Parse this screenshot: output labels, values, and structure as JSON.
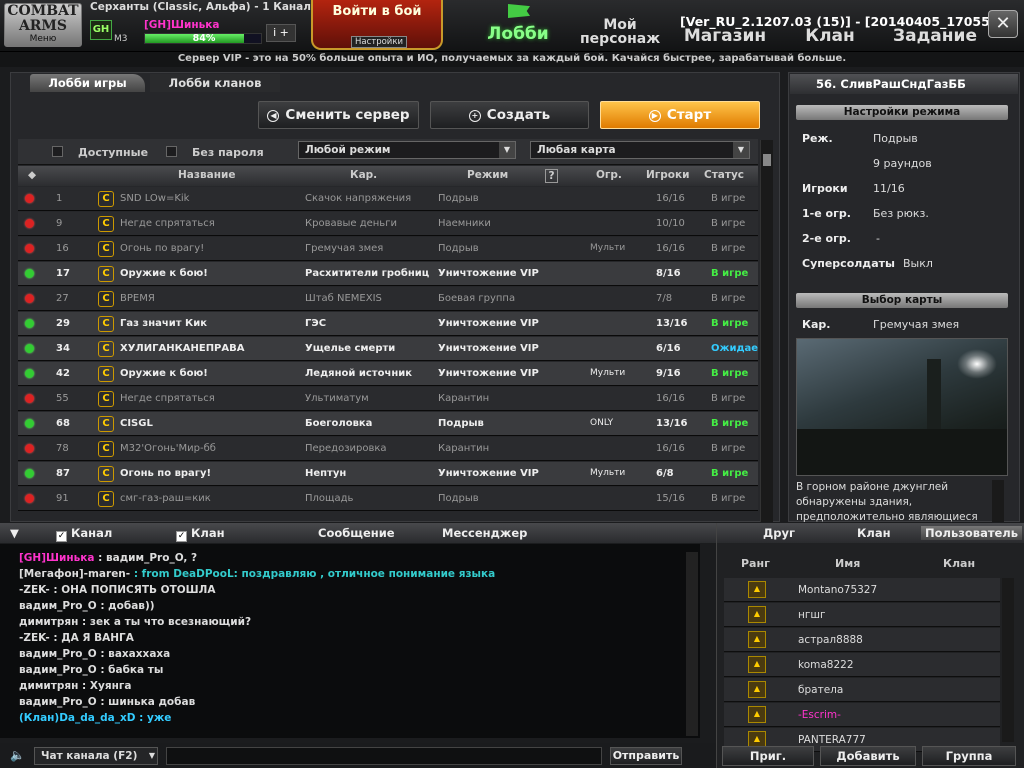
{
  "top": {
    "logo_line1": "COMBAT",
    "logo_line2": "ARMS",
    "logo_menu": "Меню",
    "server": "Серханты (Classic, Альфа) - 1 Канал",
    "rank_badge": "GH",
    "rank": "M3",
    "player": "[GH]Шинька",
    "xp_percent": "84%",
    "xp_fraction": 0.84,
    "user_icon": "i +",
    "battle_label": "Войти в бой",
    "settings_label": "Настройки",
    "nav_lobby": "Лобби",
    "nav_char": "Мой персонаж",
    "nav_shop": "Магазин",
    "nav_clan": "Клан",
    "nav_task": "Задание",
    "version": "[Ver_RU_2.1207.03 (15)] - [20140405_170551]",
    "close": "✕"
  },
  "vip_banner": "Сервер VIP - это на 50% больше опыта и ИО, получаемых за каждый бой. Качайся быстрее, зарабатывай больше.",
  "lobby": {
    "tab_game": "Лобби игры",
    "tab_clans": "Лобби кланов",
    "btn_server": "Сменить сервер",
    "btn_create": "Создать",
    "btn_start": "Старт",
    "filter_available": "Доступные",
    "filter_nopass": "Без пароля",
    "mode_select": "Любой режим",
    "map_select": "Любая карта",
    "col_name": "Название",
    "col_map": "Кар.",
    "col_mode": "Режим",
    "col_help": "?",
    "col_limit": "Огр.",
    "col_players": "Игроки",
    "col_status": "Статус",
    "rooms": [
      {
        "num": "1",
        "name": "SND LOw=Kik",
        "map": "Скачок напряжения",
        "mode": "Подрыв",
        "limit": "",
        "players": "16/16",
        "status": "В игре",
        "open": false
      },
      {
        "num": "9",
        "name": "Негде спрятаться",
        "map": "Кровавые деньги",
        "mode": "Наемники",
        "limit": "",
        "players": "10/10",
        "status": "В игре",
        "open": false
      },
      {
        "num": "16",
        "name": "Огонь по врагу!",
        "map": "Гремучая змея",
        "mode": "Подрыв",
        "limit": "Мульти",
        "players": "16/16",
        "status": "В игре",
        "open": false
      },
      {
        "num": "17",
        "name": "Оружие к бою!",
        "map": "Расхитители гробниц",
        "mode": "Уничтожение VIP",
        "limit": "",
        "players": "8/16",
        "status": "В игре",
        "open": true
      },
      {
        "num": "27",
        "name": "ВРЕМЯ",
        "map": "Штаб NEMEXIS",
        "mode": "Боевая группа",
        "limit": "",
        "players": "7/8",
        "status": "В игре",
        "open": false
      },
      {
        "num": "29",
        "name": "Газ значит Кик",
        "map": "ГЭС",
        "mode": "Уничтожение VIP",
        "limit": "",
        "players": "13/16",
        "status": "В игре",
        "open": true
      },
      {
        "num": "34",
        "name": "ХУЛИГАНКАНЕПРАВА",
        "map": "Ущелье смерти",
        "mode": "Уничтожение VIP",
        "limit": "",
        "players": "6/16",
        "status": "Ожидает",
        "open": true
      },
      {
        "num": "42",
        "name": "Оружие к бою!",
        "map": "Ледяной источник",
        "mode": "Уничтожение VIP",
        "limit": "Мульти",
        "players": "9/16",
        "status": "В игре",
        "open": true
      },
      {
        "num": "55",
        "name": "Негде спрятаться",
        "map": "Ультиматум",
        "mode": "Карантин",
        "limit": "",
        "players": "16/16",
        "status": "В игре",
        "open": false
      },
      {
        "num": "68",
        "name": "CISGL",
        "map": "Боеголовка",
        "mode": "Подрыв",
        "limit": "ONLY",
        "players": "13/16",
        "status": "В игре",
        "open": true
      },
      {
        "num": "78",
        "name": "M32'Огонь'Мир-бб",
        "map": "Передозировка",
        "mode": "Карантин",
        "limit": "",
        "players": "16/16",
        "status": "В игре",
        "open": false
      },
      {
        "num": "87",
        "name": "Огонь по врагу!",
        "map": "Нептун",
        "mode": "Уничтожение VIP",
        "limit": "Мульти",
        "players": "6/8",
        "status": "В игре",
        "open": true
      },
      {
        "num": "91",
        "name": "смг-газ-раш=кик",
        "map": "Площадь",
        "mode": "Подрыв",
        "limit": "",
        "players": "15/16",
        "status": "В игре",
        "open": false
      }
    ]
  },
  "room": {
    "title": "56. СливРашСндГазББ",
    "settings_title": "Настройки режима",
    "mode_k": "Реж.",
    "mode_v": "Подрыв",
    "rounds": "9 раундов",
    "players_k": "Игроки",
    "players_v": "11/16",
    "w1_k": "1-е огр.",
    "w1_v": "Без рюкз.",
    "w2_k": "2-е огр.",
    "w2_v": "-",
    "super_k": "Суперсолдаты",
    "super_v": "Выкл",
    "map_title": "Выбор карты",
    "map_k": "Кар.",
    "map_v": "Гремучая змея",
    "map_desc": "В горном районе джунглей обнаружены здания, предположительно являющиеся"
  },
  "chat": {
    "tab_channel": "Канал",
    "tab_clan": "Клан",
    "tab_msg": "Сообщение",
    "tab_messenger": "Мессенджер",
    "lines": [
      {
        "name": "[GH]Шинька",
        "text": ": вадим_Pro_O, ?",
        "ncolor": "#f3c",
        "tcolor": "#ddd"
      },
      {
        "name": "[Мегафон]-maren-",
        "text": ": from DeaDPooL: поздравляю , отличное понимание языка",
        "ncolor": "#ddd",
        "tcolor": "#3cc"
      },
      {
        "name": "-ZEK-",
        "text": ": ОНА ПОПИСЯТЬ ОТОШЛА",
        "ncolor": "#ddd",
        "tcolor": "#ddd"
      },
      {
        "name": "вадим_Pro_O",
        "text": ": добав))",
        "ncolor": "#ddd",
        "tcolor": "#ddd"
      },
      {
        "name": "димитрян",
        "text": ": зек а ты что всезнающий?",
        "ncolor": "#ddd",
        "tcolor": "#ddd"
      },
      {
        "name": "-ZEK-",
        "text": ": ДА Я ВАНГА",
        "ncolor": "#ddd",
        "tcolor": "#ddd"
      },
      {
        "name": "вадим_Pro_O",
        "text": ": вахаххаха",
        "ncolor": "#ddd",
        "tcolor": "#ddd"
      },
      {
        "name": "вадим_Pro_O",
        "text": ": бабка ты",
        "ncolor": "#ddd",
        "tcolor": "#ddd"
      },
      {
        "name": "димитрян",
        "text": ": Хуянга",
        "ncolor": "#ddd",
        "tcolor": "#ddd"
      },
      {
        "name": "вадим_Pro_O",
        "text": ": шинька добав",
        "ncolor": "#ddd",
        "tcolor": "#ddd"
      },
      {
        "name": "(Клан)Da_da_da_xD",
        "text": ": уже",
        "ncolor": "#3cf",
        "tcolor": "#3cf"
      }
    ],
    "channel_select": "Чат канала (F2)",
    "send": "Отправить"
  },
  "friends": {
    "tab_friend": "Друг",
    "tab_clan": "Клан",
    "tab_user": "Пользователь",
    "col_rank": "Ранг",
    "col_name": "Имя",
    "col_clan": "Клан",
    "list": [
      {
        "name": "Montano75327",
        "rank": "1",
        "color": "#ddd"
      },
      {
        "name": "нгшг",
        "rank": "1",
        "color": "#ddd"
      },
      {
        "name": "астрал8888",
        "rank": "2",
        "color": "#ddd"
      },
      {
        "name": "koma8222",
        "rank": "3",
        "color": "#ddd"
      },
      {
        "name": "братела",
        "rank": "3",
        "color": "#ddd"
      },
      {
        "name": "-Escrim-",
        "rank": "2",
        "color": "#f3c"
      },
      {
        "name": "PANTERA777",
        "rank": "2",
        "color": "#ddd"
      }
    ],
    "btn_invite": "Приг.",
    "btn_add": "Добавить",
    "btn_group": "Группа"
  }
}
